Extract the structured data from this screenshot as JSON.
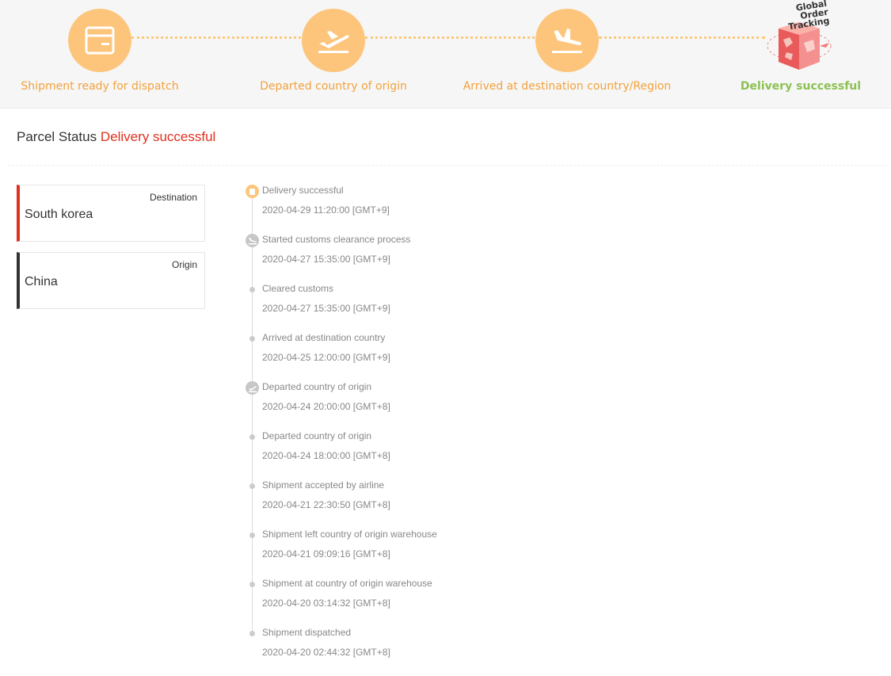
{
  "progress": {
    "steps": [
      {
        "label": "Shipment ready for dispatch",
        "icon": "package-icon"
      },
      {
        "label": "Departed country of origin",
        "icon": "plane-departure-icon"
      },
      {
        "label": "Arrived at destination country/Region",
        "icon": "plane-arrival-icon"
      },
      {
        "label": "Delivery successful",
        "icon": "global-order-tracking-box-icon"
      }
    ],
    "final_icon_caption": "Global Order Tracking",
    "accent_color": "#fdc57b",
    "label_color": "#f2a23c",
    "done_color": "#8dc153"
  },
  "parcel_status": {
    "label": "Parcel Status",
    "value": "Delivery successful",
    "value_color": "#e0301e"
  },
  "cards": {
    "destination": {
      "tag": "Destination",
      "place": "South korea",
      "accent": "#e0301e"
    },
    "origin": {
      "tag": "Origin",
      "place": "China",
      "accent": "#333333"
    }
  },
  "events": [
    {
      "title": "Delivery successful",
      "time": "2020-04-29 11:20:00 [GMT+9]",
      "marker": "delivered-icon"
    },
    {
      "title": "Started customs clearance process",
      "time": "2020-04-27 15:35:00 [GMT+9]",
      "marker": "plane-arrival-icon"
    },
    {
      "title": "Cleared customs",
      "time": "2020-04-27 15:35:00 [GMT+9]",
      "marker": "dot"
    },
    {
      "title": "Arrived at destination country",
      "time": "2020-04-25 12:00:00 [GMT+9]",
      "marker": "dot"
    },
    {
      "title": "Departed country of origin",
      "time": "2020-04-24 20:00:00 [GMT+8]",
      "marker": "plane-departure-icon"
    },
    {
      "title": "Departed country of origin",
      "time": "2020-04-24 18:00:00 [GMT+8]",
      "marker": "dot"
    },
    {
      "title": "Shipment accepted by airline",
      "time": "2020-04-21 22:30:50 [GMT+8]",
      "marker": "dot"
    },
    {
      "title": "Shipment left country of origin warehouse",
      "time": "2020-04-21 09:09:16 [GMT+8]",
      "marker": "dot"
    },
    {
      "title": "Shipment at country of origin warehouse",
      "time": "2020-04-20 03:14:32 [GMT+8]",
      "marker": "dot"
    },
    {
      "title": "Shipment dispatched",
      "time": "2020-04-20 02:44:32 [GMT+8]",
      "marker": "dot"
    }
  ]
}
